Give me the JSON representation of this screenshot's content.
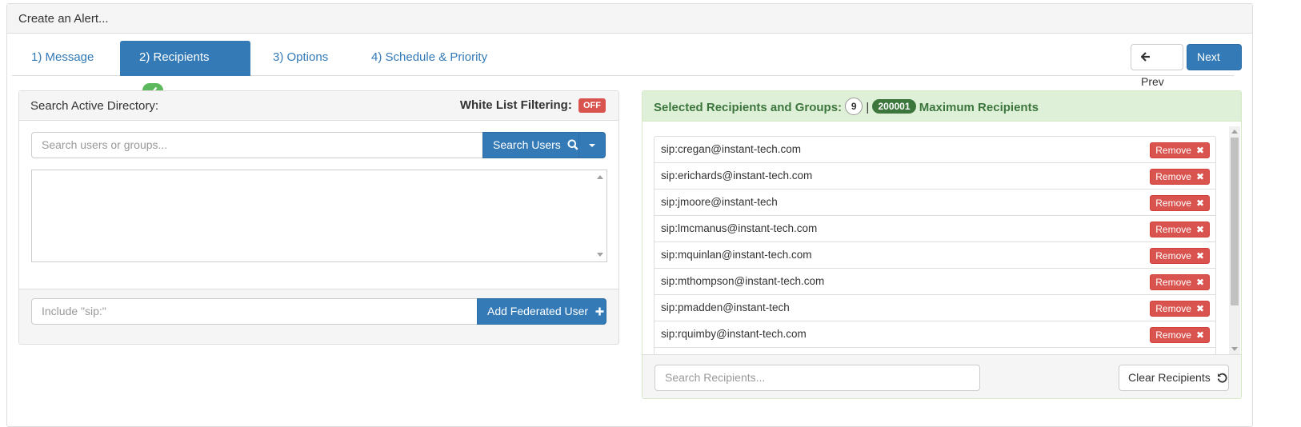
{
  "header": {
    "title": "Create an Alert..."
  },
  "tabs": [
    {
      "label": "1) Message"
    },
    {
      "label": "2) Recipients"
    },
    {
      "label": "3) Options"
    },
    {
      "label": "4) Schedule & Priority"
    }
  ],
  "nav": {
    "prev_label": "Prev",
    "next_label": "Next"
  },
  "search_panel": {
    "title": "Search Active Directory:",
    "white_list_label": "White List Filtering:",
    "white_list_status": "OFF",
    "search_placeholder": "Search users or groups...",
    "search_button": "Search Users",
    "federated_placeholder": "Include \"sip:\"",
    "federated_button": "Add Federated User"
  },
  "recipients_panel": {
    "title": "Selected Recipients and Groups:",
    "count": "9",
    "separator": "|",
    "max_value": "200001",
    "max_label": "Maximum Recipients",
    "remove_label": "Remove",
    "items": [
      "sip:cregan@instant-tech.com",
      "sip:erichards@instant-tech.com",
      "sip:jmoore@instant-tech",
      "sip:lmcmanus@instant-tech.com",
      "sip:mquinlan@instant-tech.com",
      "sip:mthompson@instant-tech.com",
      "sip:pmadden@instant-tech",
      "sip:rquimby@instant-tech.com"
    ],
    "search_placeholder": "Search Recipients...",
    "clear_button": "Clear Recipients"
  }
}
